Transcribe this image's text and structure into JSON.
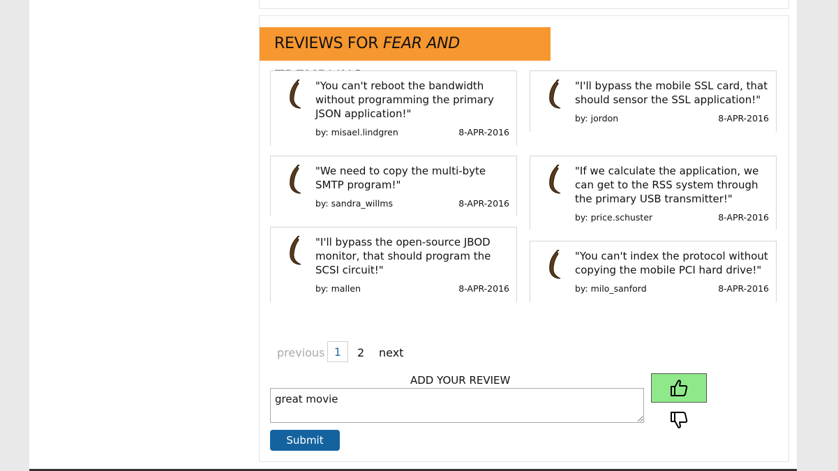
{
  "reviews_section": {
    "header_prefix": "REVIEWS FOR ",
    "header_title": "FEAR AND TREMBLING",
    "header_color": "#f7972f"
  },
  "reviews": [
    {
      "quote": "\"You can't reboot the bandwidth without programming the primary JSON application!\"",
      "author": "by: misael.lindgren",
      "date": "8-APR-2016"
    },
    {
      "quote": "\"I'll bypass the mobile SSL card, that should sensor the SSL application!\"",
      "author": "by: jordon",
      "date": "8-APR-2016"
    },
    {
      "quote": "\"We need to copy the multi-byte SMTP program!\"",
      "author": "by: sandra_willms",
      "date": "8-APR-2016"
    },
    {
      "quote": "\"If we calculate the application, we can get to the RSS system through the primary USB transmitter!\"",
      "author": "by: price.schuster",
      "date": "8-APR-2016"
    },
    {
      "quote": "\"I'll bypass the open-source JBOD monitor, that should program the SCSI circuit!\"",
      "author": "by: mallen",
      "date": "8-APR-2016"
    },
    {
      "quote": "\"You can't index the protocol without copying the mobile PCI hard drive!\"",
      "author": "by: milo_sanford",
      "date": "8-APR-2016"
    }
  ],
  "pagination": {
    "previous": "previous",
    "page1": "1",
    "page2": "2",
    "next": "next"
  },
  "add_review": {
    "label": "ADD YOUR REVIEW",
    "input_value": "great movie",
    "submit_label": "Submit",
    "thumbs_up_icon": "thumbs-up-icon",
    "thumbs_down_icon": "thumbs-down-icon",
    "thumbs_up_bg": "#8fe98a",
    "submit_bg": "#14639f"
  }
}
